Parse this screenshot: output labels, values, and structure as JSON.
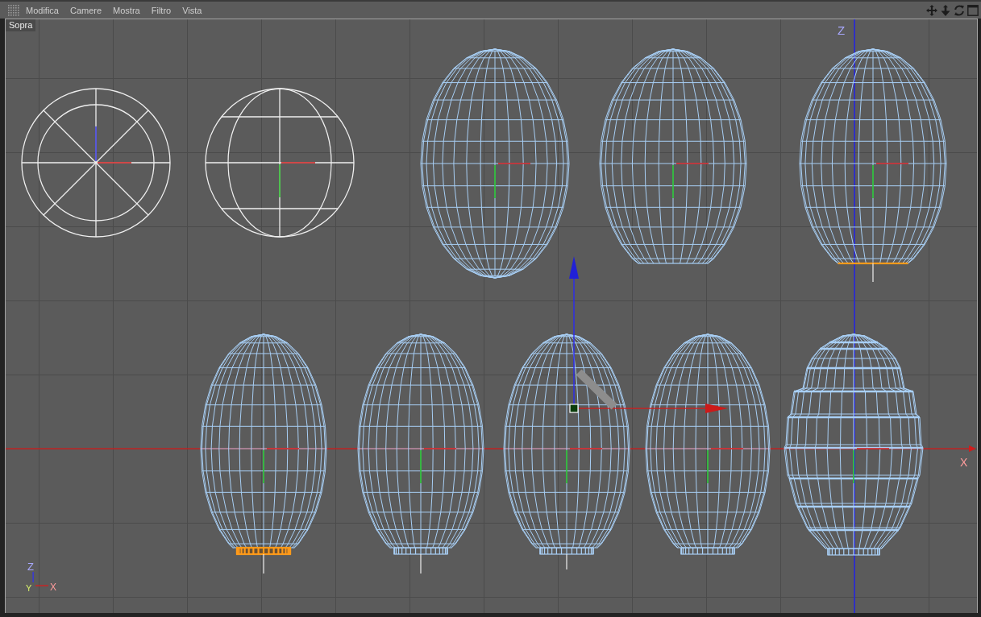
{
  "menu_bar": {
    "items": [
      "Modifica",
      "Camere",
      "Mostra",
      "Filtro",
      "Vista"
    ]
  },
  "viewport": {
    "view_label": "Sopra",
    "axis_labels": {
      "vertical": "Z",
      "horizontal": "X"
    },
    "corner_axes": {
      "vertical": "Z",
      "depth": "Y",
      "horizontal": "X"
    },
    "models": [
      {
        "kind": "disc",
        "selected": false
      },
      {
        "kind": "sphere",
        "selected": false
      },
      {
        "kind": "egg",
        "selected": false
      },
      {
        "kind": "egg-open",
        "selected": false
      },
      {
        "kind": "egg-open",
        "selected": true
      },
      {
        "kind": "egg-capped",
        "selected": true
      },
      {
        "kind": "egg-capped",
        "selected": false
      },
      {
        "kind": "egg-capped",
        "selected": false
      },
      {
        "kind": "egg-capped",
        "selected": false
      },
      {
        "kind": "egg-ringed",
        "selected": false
      }
    ]
  }
}
